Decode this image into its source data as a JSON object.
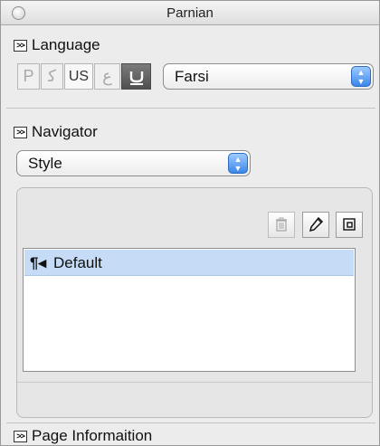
{
  "window": {
    "title": "Parnian"
  },
  "language": {
    "header": "Language",
    "buttons": [
      "P",
      "ﮐ",
      "US",
      "ع",
      ""
    ],
    "select": {
      "value": "Farsi"
    }
  },
  "navigator": {
    "header": "Navigator",
    "select": {
      "value": "Style"
    }
  },
  "styles_panel": {
    "toolbar": [
      {
        "icon": "trash-icon",
        "glyph": "🗑"
      },
      {
        "icon": "pencil-icon",
        "glyph": "✎"
      },
      {
        "icon": "new-style-icon",
        "glyph": "⧉"
      }
    ],
    "items": [
      {
        "glyph": "¶◂",
        "label": "Default",
        "selected": true
      }
    ]
  },
  "page_info": {
    "header": "Page Informaition"
  }
}
